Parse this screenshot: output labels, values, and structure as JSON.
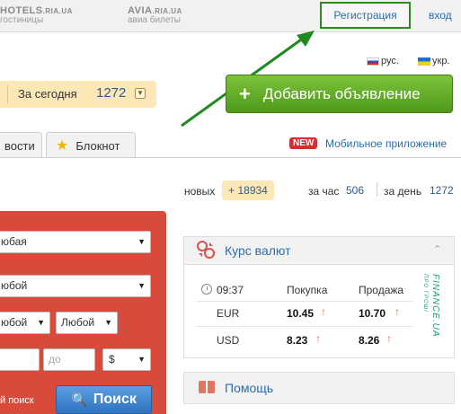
{
  "topbar": {
    "hotels": {
      "name": "HOTELS",
      "domain": ".RIA.UA",
      "sub": "гостиницы"
    },
    "avia": {
      "name": "AVIA",
      "domain": ".RIA.UA",
      "sub": "авиа билеты"
    },
    "register_label": "Регистрация",
    "login_label": "вход"
  },
  "languages": [
    {
      "label": "рус."
    },
    {
      "label": "укр."
    }
  ],
  "counter": {
    "label": "За сегодня",
    "count": "1272",
    "dropdown_icon": "chevron-down-icon"
  },
  "add_button": {
    "label": "Добавить объявление",
    "icon": "plus-icon"
  },
  "tabs": [
    {
      "label": "вости"
    },
    {
      "label": "Блокнот",
      "icon": "star-icon"
    }
  ],
  "mobile": {
    "badge": "NEW",
    "label": "Мобильное приложение"
  },
  "stats": {
    "new_label": "новых",
    "new_count": "+ 18934",
    "per_hour_label": "за час",
    "per_hour_value": "506",
    "per_day_label": "за день",
    "per_day_value": "1272"
  },
  "search_panel": {
    "select1": "юбая",
    "select2": "юбой",
    "select3": "юбой",
    "select4": "Любой",
    "from_placeholder": "",
    "to_placeholder": "до",
    "currency": "$",
    "extended_label": "й поиск",
    "search_label": "Поиск"
  },
  "currency_widget": {
    "title": "Курс валют",
    "time": "09:37",
    "buy_header": "Покупка",
    "sell_header": "Продажа",
    "rows": [
      {
        "code": "EUR",
        "buy": "10.45",
        "sell": "10.70"
      },
      {
        "code": "USD",
        "buy": "8.23",
        "sell": "8.26"
      }
    ],
    "arrow": "↑",
    "logo": "FINANCE.UA",
    "logo_sub": "ПРО ГРОШІ"
  },
  "help": {
    "title": "Помощь"
  },
  "colors": {
    "accent_green": "#4e9a1b",
    "link_blue": "#2a6db0",
    "panel_red": "#d84b3a",
    "badge_yellow": "#fbe8b6"
  }
}
